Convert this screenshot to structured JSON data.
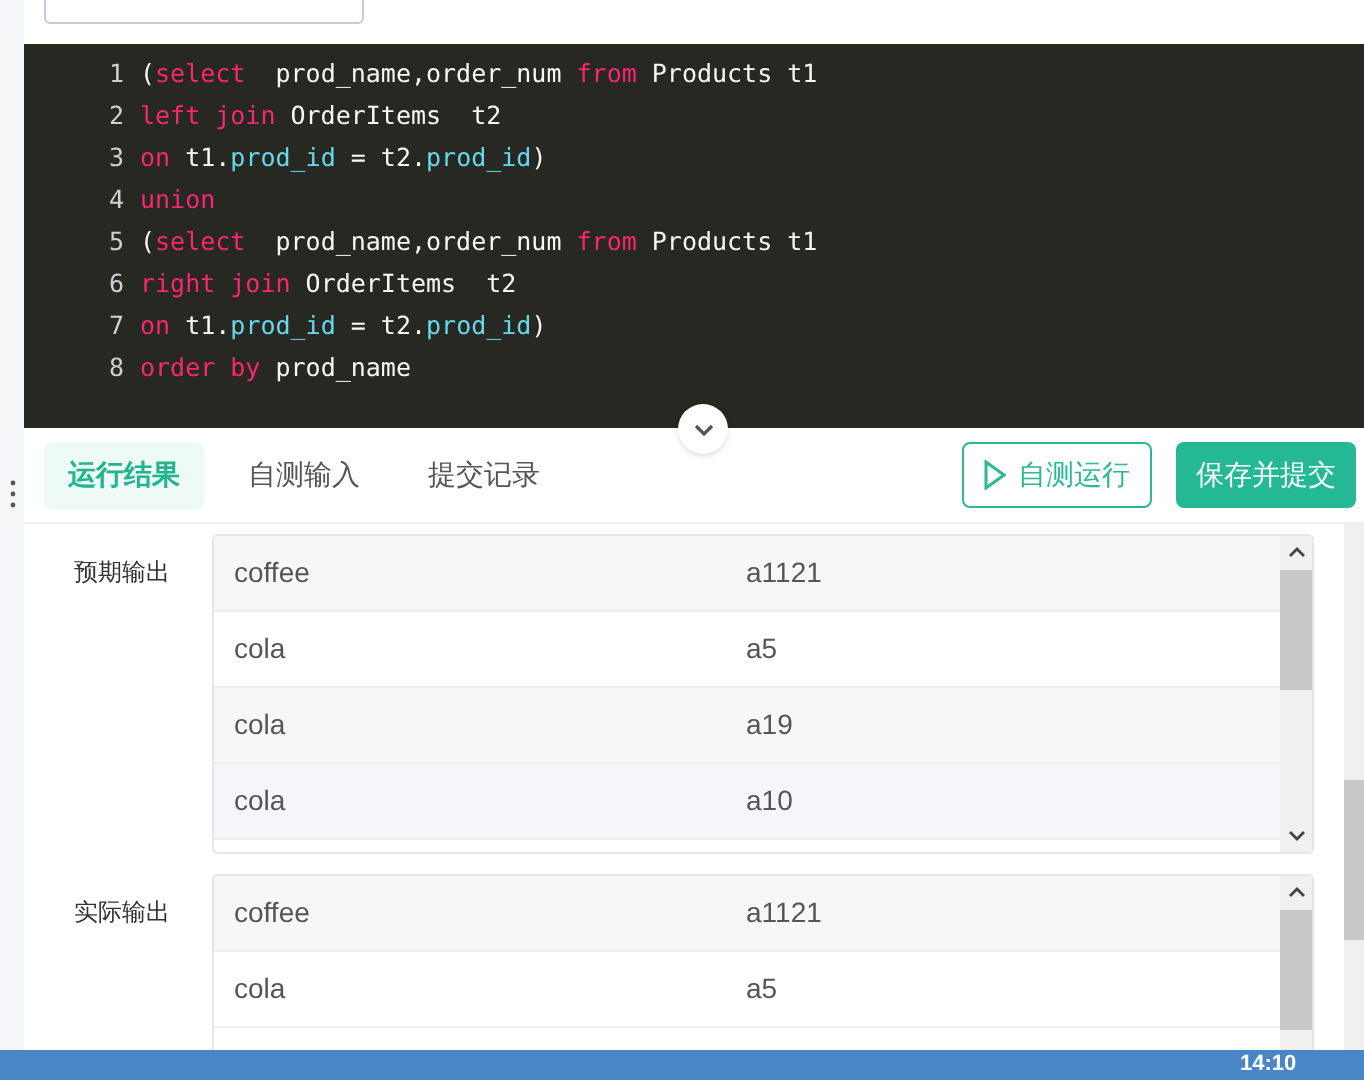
{
  "code_lines": [
    {
      "number": "1",
      "tokens": [
        {
          "kind": "plain",
          "text": "("
        },
        {
          "kind": "keyword",
          "text": "select"
        },
        {
          "kind": "plain",
          "text": "  prod_name,order_num "
        },
        {
          "kind": "keyword",
          "text": "from"
        },
        {
          "kind": "plain",
          "text": " Products t1"
        }
      ]
    },
    {
      "number": "2",
      "tokens": [
        {
          "kind": "keyword",
          "text": "left join"
        },
        {
          "kind": "plain",
          "text": " OrderItems  t2"
        }
      ]
    },
    {
      "number": "3",
      "tokens": [
        {
          "kind": "keyword",
          "text": "on"
        },
        {
          "kind": "plain",
          "text": " t1."
        },
        {
          "kind": "field",
          "text": "prod_id"
        },
        {
          "kind": "plain",
          "text": " = t2."
        },
        {
          "kind": "field",
          "text": "prod_id"
        },
        {
          "kind": "plain",
          "text": ")"
        }
      ]
    },
    {
      "number": "4",
      "tokens": [
        {
          "kind": "keyword",
          "text": "union"
        }
      ]
    },
    {
      "number": "5",
      "tokens": [
        {
          "kind": "plain",
          "text": "("
        },
        {
          "kind": "keyword",
          "text": "select"
        },
        {
          "kind": "plain",
          "text": "  prod_name,order_num "
        },
        {
          "kind": "keyword",
          "text": "from"
        },
        {
          "kind": "plain",
          "text": " Products t1"
        }
      ]
    },
    {
      "number": "6",
      "tokens": [
        {
          "kind": "keyword",
          "text": "right join"
        },
        {
          "kind": "plain",
          "text": " OrderItems  t2"
        }
      ]
    },
    {
      "number": "7",
      "tokens": [
        {
          "kind": "keyword",
          "text": "on"
        },
        {
          "kind": "plain",
          "text": " t1."
        },
        {
          "kind": "field",
          "text": "prod_id"
        },
        {
          "kind": "plain",
          "text": " = t2."
        },
        {
          "kind": "field",
          "text": "prod_id"
        },
        {
          "kind": "plain",
          "text": ")"
        }
      ]
    },
    {
      "number": "8",
      "tokens": [
        {
          "kind": "keyword",
          "text": "order by"
        },
        {
          "kind": "plain",
          "text": " prod_name"
        }
      ]
    }
  ],
  "tabs": [
    {
      "label": "运行结果",
      "selected": true
    },
    {
      "label": "自测输入",
      "selected": false
    },
    {
      "label": "提交记录",
      "selected": false
    }
  ],
  "buttons": [
    {
      "label": "自测运行",
      "kind": "outline"
    },
    {
      "label": "保存并提交",
      "kind": "primary"
    }
  ],
  "outputs": [
    {
      "label": "预期输出",
      "rows": [
        [
          "coffee",
          "a1121"
        ],
        [
          "cola",
          "a5"
        ],
        [
          "cola",
          "a19"
        ],
        [
          "cola",
          "a10"
        ]
      ]
    },
    {
      "label": "实际输出",
      "rows": [
        [
          "coffee",
          "a1121"
        ],
        [
          "cola",
          "a5"
        ]
      ]
    }
  ],
  "taskbar": {
    "time": "14:10"
  }
}
